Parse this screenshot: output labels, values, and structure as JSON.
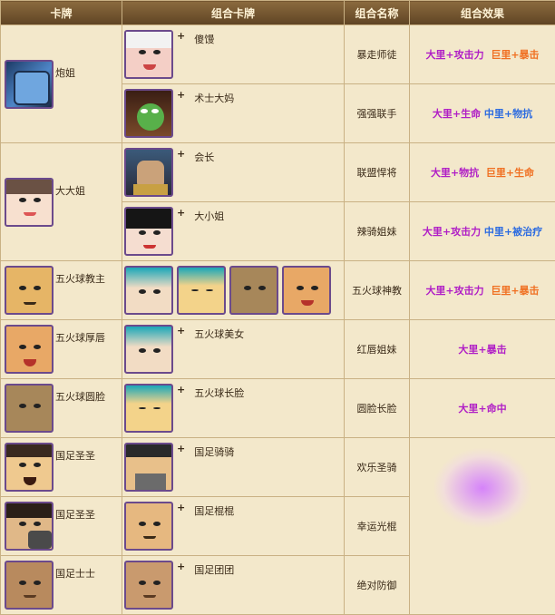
{
  "headers": [
    "卡牌",
    "组合卡牌",
    "组合名称",
    "组合效果"
  ],
  "plus_sign": "+",
  "rows": [
    {
      "card": "炮姐",
      "combo_name": "暴走师徒",
      "partners": [
        "傻馒"
      ],
      "effect": [
        {
          "text": "大里+攻击力",
          "color": "purple"
        },
        {
          "text": "巨里+暴击",
          "color": "orange"
        }
      ]
    },
    {
      "card": "",
      "combo_name": "强强联手",
      "partners": [
        "术士大妈"
      ],
      "effect": [
        {
          "text": "大里+生命",
          "color": "purple"
        },
        {
          "text": "中里+物抗",
          "color": "blue"
        }
      ]
    },
    {
      "card": "大大姐",
      "combo_name": "联盟悍将",
      "partners": [
        "会长"
      ],
      "effect": [
        {
          "text": "大里+物抗",
          "color": "purple"
        },
        {
          "text": "巨里+生命",
          "color": "orange"
        }
      ]
    },
    {
      "card": "",
      "combo_name": "辣骑姐妹",
      "partners": [
        "大小姐"
      ],
      "effect": [
        {
          "text": "大里+攻击力",
          "color": "purple"
        },
        {
          "text": "中里+被治疗",
          "color": "blue"
        }
      ]
    },
    {
      "card": "五火球教主",
      "combo_name": "五火球神教",
      "partners": [],
      "effect": [
        {
          "text": "大里+攻击力",
          "color": "purple"
        },
        {
          "text": "巨里+暴击",
          "color": "orange"
        }
      ]
    },
    {
      "card": "五火球厚唇",
      "combo_name": "红唇姐妹",
      "partners": [
        "五火球美女"
      ],
      "effect": [
        {
          "text": "大里+暴击",
          "color": "purple"
        }
      ]
    },
    {
      "card": "五火球圆脸",
      "combo_name": "圆脸长脸",
      "partners": [
        "五火球长脸"
      ],
      "effect": [
        {
          "text": "大里+命中",
          "color": "purple"
        }
      ]
    },
    {
      "card": "国足圣圣",
      "combo_name": "欢乐圣骑",
      "partners": [
        "国足骑骑"
      ],
      "effect": []
    },
    {
      "card": "国足圣圣",
      "combo_name": "幸运光棍",
      "partners": [
        "国足棍棍"
      ],
      "effect": []
    },
    {
      "card": "国足士士",
      "combo_name": "绝对防御",
      "partners": [
        "国足团团"
      ],
      "effect": []
    }
  ],
  "colors": {
    "purple": "#b01ec6",
    "orange": "#f07022",
    "blue": "#2c6be0",
    "header_bg": "#6f5230",
    "cell_bg": "#f3e8cb"
  }
}
